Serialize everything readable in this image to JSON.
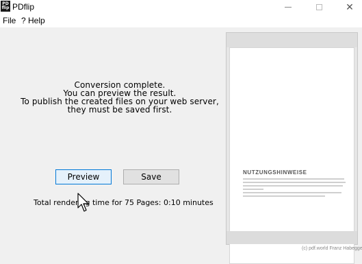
{
  "window": {
    "title": "PDflip",
    "icon_lines": [
      "PD",
      "flip"
    ],
    "minimize_icon": "minimize-icon",
    "maximize_icon": "maximize-icon",
    "close_icon": "close-icon"
  },
  "menu": {
    "items": [
      {
        "label": "File"
      },
      {
        "label": "? Help"
      }
    ]
  },
  "status": {
    "lines": [
      "Conversion complete.",
      "You can preview the result.",
      "To publish the created files on your web server,",
      "they must be saved first."
    ]
  },
  "buttons": {
    "preview": "Preview",
    "save": "Save"
  },
  "render_info": "Total rendering time for 75 Pages: 0:10 minutes",
  "preview": {
    "page_heading": "NUTZUNGSHINWEISE"
  },
  "footer": {
    "copyright": "(c) pdf.world Franz Habegger"
  }
}
